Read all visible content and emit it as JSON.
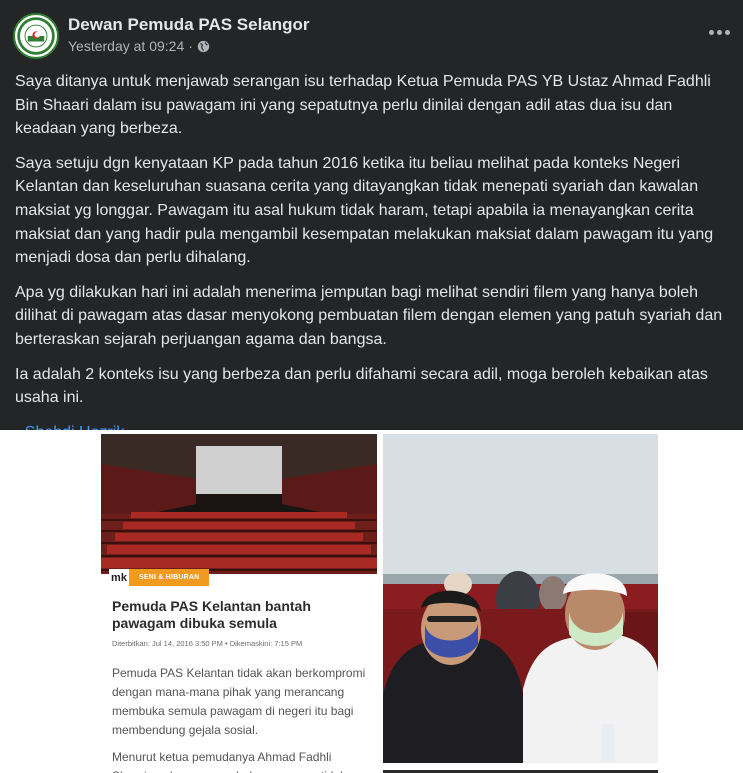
{
  "post": {
    "page_name": "Dewan Pemuda PAS Selangor",
    "timestamp": "Yesterday at 09:24",
    "separator": "·",
    "paragraphs": [
      "Saya ditanya untuk menjawab serangan isu terhadap Ketua Pemuda PAS YB Ustaz Ahmad Fadhli Bin Shaari dalam isu pawagam ini yang sepatutnya perlu dinilai dengan adil atas dua isu dan keadaan yang berbeza.",
      "Saya setuju dgn kenyataan KP pada tahun 2016 ketika itu beliau melihat pada konteks Negeri Kelantan dan keseluruhan suasana cerita yang ditayangkan tidak menepati syariah dan kawalan maksiat yg longgar. Pawagam itu asal hukum tidak haram, tetapi apabila ia menayangkan cerita maksiat dan yang hadir pula mengambil kesempatan melakukan maksiat dalam pawagam itu yang menjadi dosa dan perlu dihalang.",
      "Apa yg dilakukan hari ini adalah menerima jemputan bagi melihat sendiri filem yang hanya boleh dilihat di pawagam atas dasar menyokong pembuatan filem dengan elemen yang patuh syariah dan berteraskan sejarah perjuangan agama dan bangsa.",
      "Ia adalah 2 konteks isu yang berbeza dan perlu difahami secara adil, moga beroleh kebaikan atas usaha ini."
    ],
    "signature_prefix": "- ",
    "signature_name": "Shehdi Hazrik"
  },
  "article": {
    "logo": "mk",
    "category": "SENI & HIBURAN",
    "title": "Pemuda PAS Kelantan bantah pawagam dibuka semula",
    "date_line": "Diterbitkan: Jul 14, 2016 3:50 PM  •  Dikemaskini: 7:15 PM",
    "para1": "Pemuda PAS Kelantan tidak akan berkompromi dengan mana-mana pihak yang merancang membuka semula pawagam di negeri itu bagi membendung gejala sosial.",
    "para2": "Menurut ketua pemudanya Ahmad Fadhli Shaari, cadangan membuka pawagam tidak"
  },
  "icons": {
    "avatar": "party-logo-icon",
    "audience": "globe-icon",
    "menu": "more-options-icon"
  },
  "colors": {
    "post_bg": "#242526",
    "text": "#e4e6eb",
    "secondary": "#b0b3b8",
    "link": "#4599ff",
    "tag": "#f29a1f"
  }
}
